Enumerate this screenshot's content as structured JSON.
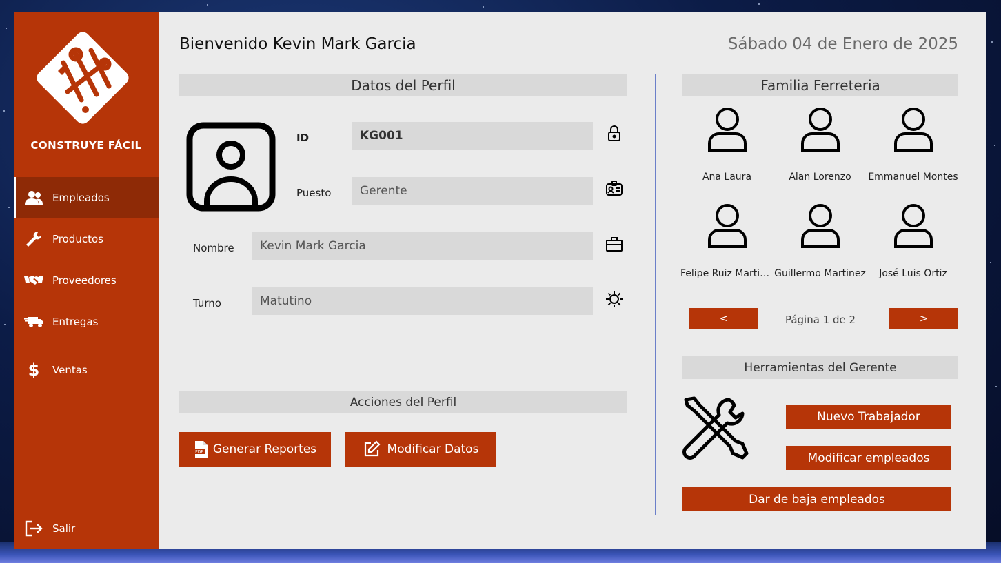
{
  "brand": {
    "name": "CONSTRUYE FÁCIL",
    "logo_icon": "tools-diamond-logo",
    "accent_color": "#b63508",
    "active_color": "#8e2a06"
  },
  "sidebar": {
    "items": [
      {
        "label": "Empleados",
        "icon": "users-icon",
        "active": true
      },
      {
        "label": "Productos",
        "icon": "wrench-icon",
        "active": false
      },
      {
        "label": "Proveedores",
        "icon": "handshake-icon",
        "active": false
      },
      {
        "label": "Entregas",
        "icon": "truck-icon",
        "active": false
      },
      {
        "label": "Ventas",
        "icon": "dollar-icon",
        "active": false
      }
    ],
    "logout": {
      "label": "Salir",
      "icon": "logout-icon"
    }
  },
  "header": {
    "welcome": "Bienvenido Kevin Mark Garcia",
    "date": "Sábado 04 de Enero de 2025"
  },
  "profile": {
    "section_title": "Datos del Perfil",
    "fields": {
      "id": {
        "label": "ID",
        "value": "KG001",
        "icon": "lock-icon"
      },
      "puesto": {
        "label": "Puesto",
        "value": "Gerente",
        "icon": "id-badge-icon"
      },
      "nombre": {
        "label": "Nombre",
        "value": "Kevin Mark Garcia",
        "icon": "briefcase-icon"
      },
      "turno": {
        "label": "Turno",
        "value": "Matutino",
        "icon": "sun-icon"
      }
    }
  },
  "actions": {
    "section_title": "Acciones del Perfil",
    "generate_reports": "Generar Reportes",
    "modify_data": "Modificar Datos"
  },
  "family": {
    "section_title": "Familia Ferreteria",
    "members": [
      "Ana Laura",
      "Alan Lorenzo",
      "Emmanuel Montes",
      "Felipe Ruiz Martinez",
      "Guillermo Martinez",
      "José Luis Ortiz"
    ],
    "prev_label": "<",
    "next_label": ">",
    "page_label": "Página 1 de 2"
  },
  "manager_tools": {
    "section_title": "Herramientas del Gerente",
    "new_worker": "Nuevo Trabajador",
    "modify_employees": "Modificar empleados",
    "remove_employees": "Dar de baja empleados"
  }
}
